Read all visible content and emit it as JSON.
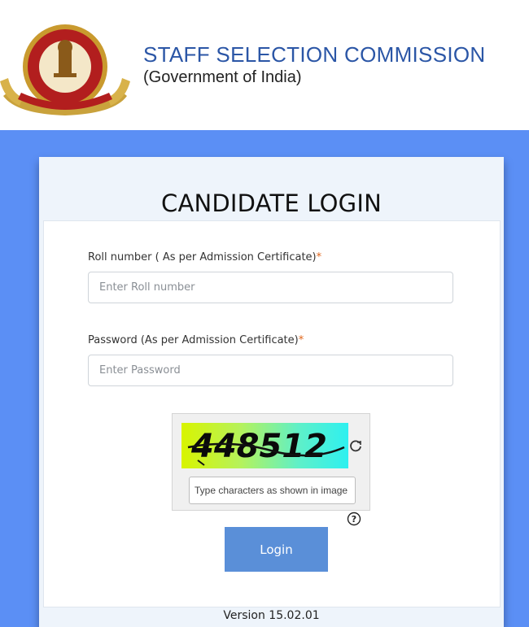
{
  "header": {
    "org_name": "STAFF SELECTION COMMISSION",
    "org_sub": "(Government of India)",
    "logo_icon": "ssc-emblem-icon"
  },
  "login": {
    "title": "CANDIDATE LOGIN",
    "roll": {
      "label": "Roll number ( As per Admission Certificate)",
      "required_mark": "*",
      "placeholder": "Enter Roll number",
      "value": ""
    },
    "password": {
      "label": "Password (As per Admission Certificate)",
      "required_mark": "*",
      "placeholder": "Enter Password",
      "value": ""
    },
    "captcha": {
      "text": "448512",
      "placeholder": "Type characters as shown in image",
      "refresh_icon": "refresh-icon",
      "help_icon": "question-circle-icon"
    },
    "login_label": "Login",
    "version": "Version 15.02.01"
  },
  "colors": {
    "background": "#5b8ff5",
    "brand_text": "#2b56a6",
    "button": "#5a8fd8",
    "required": "#e0661c"
  }
}
